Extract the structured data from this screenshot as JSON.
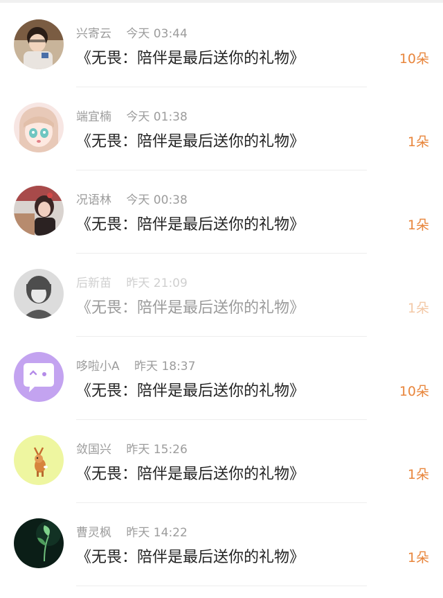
{
  "gift_list": {
    "items": [
      {
        "name": "兴寄云",
        "time": "今天 03:44",
        "title": "《无畏：陪伴是最后送你的礼物》",
        "count": "10朵",
        "avatar_icon": "child-photo-avatar"
      },
      {
        "name": "端宜楠",
        "time": "今天 01:38",
        "title": "《无畏：陪伴是最后送你的礼物》",
        "count": "1朵",
        "avatar_icon": "anime-girl-avatar"
      },
      {
        "name": "况语林",
        "time": "今天 00:38",
        "title": "《无畏：陪伴是最后送你的礼物》",
        "count": "1朵",
        "avatar_icon": "woman-photo-avatar"
      },
      {
        "name": "后新苗",
        "time": "昨天 21:09",
        "title": "《无畏：陪伴是最后送你的礼物》",
        "count": "1朵",
        "avatar_icon": "grayscale-person-avatar"
      },
      {
        "name": "哆啦小A",
        "time": "昨天 18:37",
        "title": "《无畏：陪伴是最后送你的礼物》",
        "count": "10朵",
        "avatar_icon": "chat-bubble-face-avatar"
      },
      {
        "name": "敛国兴",
        "time": "昨天 15:26",
        "title": "《无畏：陪伴是最后送你的礼物》",
        "count": "1朵",
        "avatar_icon": "cartoon-deer-avatar"
      },
      {
        "name": "曹灵枫",
        "time": "昨天 14:22",
        "title": "《无畏：陪伴是最后送你的礼物》",
        "count": "1朵",
        "avatar_icon": "green-sprout-avatar"
      }
    ]
  },
  "colors": {
    "count_accent": "#e8853b",
    "name_gray": "#9c9c9c",
    "title_text": "#222222"
  }
}
